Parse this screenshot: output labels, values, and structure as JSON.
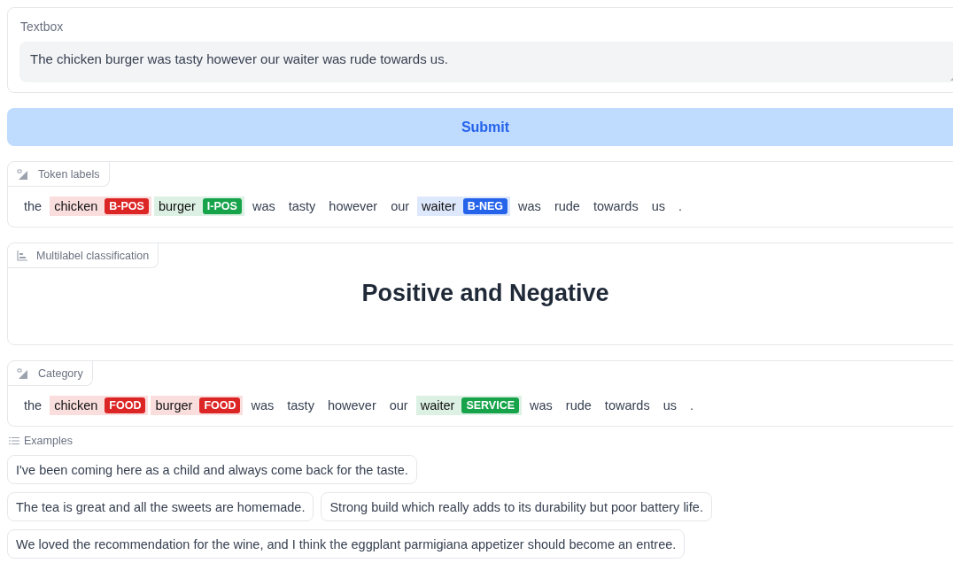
{
  "textbox": {
    "label": "Textbox",
    "value": "The chicken burger was tasty however our waiter was rude towards us."
  },
  "submit_button": {
    "label": "Submit"
  },
  "token_labels": {
    "label": "Token labels",
    "tokens": [
      {
        "text": "the"
      },
      {
        "text": "chicken",
        "tag": "B-POS",
        "color": "#dc2626"
      },
      {
        "text": "burger",
        "tag": "I-POS",
        "color": "#16a34a"
      },
      {
        "text": "was"
      },
      {
        "text": "tasty"
      },
      {
        "text": "however"
      },
      {
        "text": "our"
      },
      {
        "text": "waiter",
        "tag": "B-NEG",
        "color": "#2563eb"
      },
      {
        "text": "was"
      },
      {
        "text": "rude"
      },
      {
        "text": "towards"
      },
      {
        "text": "us"
      },
      {
        "text": "."
      }
    ]
  },
  "multilabel": {
    "label": "Multilabel classification",
    "result": "Positive and Negative"
  },
  "category": {
    "label": "Category",
    "tokens": [
      {
        "text": "the"
      },
      {
        "text": "chicken",
        "tag": "FOOD",
        "color": "#dc2626"
      },
      {
        "text": "burger",
        "tag": "FOOD",
        "color": "#dc2626"
      },
      {
        "text": "was"
      },
      {
        "text": "tasty"
      },
      {
        "text": "however"
      },
      {
        "text": "our"
      },
      {
        "text": "waiter",
        "tag": "SERVICE",
        "color": "#16a34a"
      },
      {
        "text": "was"
      },
      {
        "text": "rude"
      },
      {
        "text": "towards"
      },
      {
        "text": "us"
      },
      {
        "text": "."
      }
    ]
  },
  "examples": {
    "label": "Examples",
    "items": [
      "I've been coming here as a child and always come back for the taste.",
      "The tea is great and all the sweets are homemade.",
      "Strong build which really adds to its durability but poor battery life.",
      "We loved the recommendation for the wine, and I think the eggplant parmigiana appetizer should become an entree."
    ]
  }
}
